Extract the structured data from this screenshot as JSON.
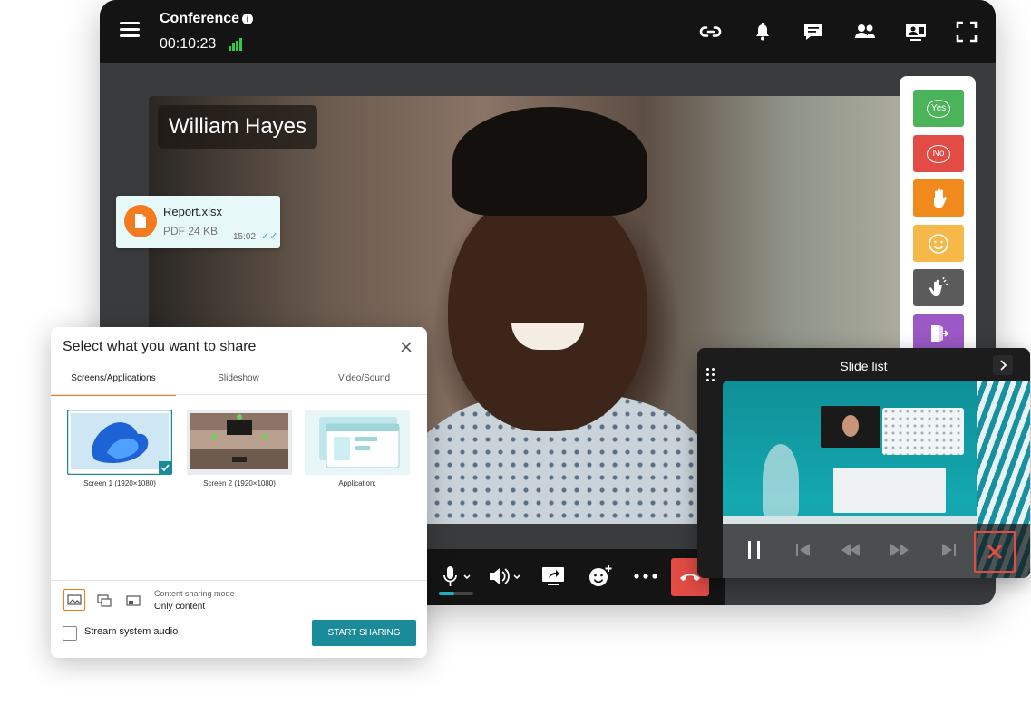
{
  "conference": {
    "title": "Conference",
    "timer": "00:10:23"
  },
  "participant": {
    "name": "William Hayes"
  },
  "reactions": {
    "yes_label": "Yes",
    "no_label": "No",
    "colors": {
      "yes": "#4bb35a",
      "no": "#e34c45",
      "raise_hand": "#f08a1c",
      "smile": "#f7b84a",
      "applause": "#5b5b5b",
      "leave": "#9b59c6"
    }
  },
  "file_message": {
    "name": "Report.xlsx",
    "meta": "PDF 24 KB",
    "time": "15:02"
  },
  "share_dialog": {
    "title": "Select what you want to share",
    "tabs": [
      "Screens/Applications",
      "Slideshow",
      "Video/Sound"
    ],
    "sources": [
      "Screen 1 (1920×1080)",
      "Screen 2 (1920×1080)",
      "Application:"
    ],
    "mode_caption": "Content sharing mode",
    "mode_value": "Only content",
    "stream_audio_label": "Stream system audio",
    "start_button": "START SHARING"
  },
  "slide_list": {
    "title": "Slide list"
  },
  "colors": {
    "accent": "#f47a20",
    "teal": "#1b8b99",
    "hangup": "#e34c45",
    "signal": "#2ecc40"
  }
}
